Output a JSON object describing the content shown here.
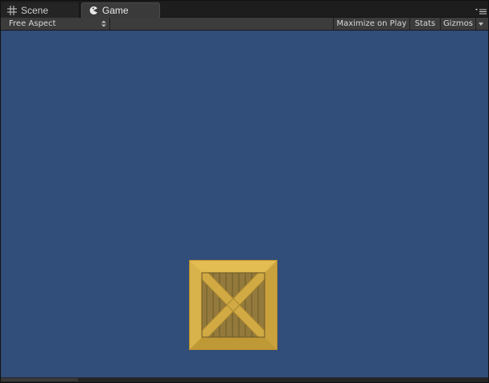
{
  "tabs": {
    "scene": {
      "label": "Scene",
      "icon": "grid-icon"
    },
    "game": {
      "label": "Game",
      "icon": "pacman-icon",
      "active": true
    }
  },
  "toolbar": {
    "aspect": "Free Aspect",
    "maximize_label": "Maximize on Play",
    "stats_label": "Stats",
    "gizmos_label": "Gizmos"
  },
  "game": {
    "background_color": "#314d79",
    "objects": [
      {
        "name": "crate",
        "icon": "wooden-crate"
      }
    ]
  }
}
